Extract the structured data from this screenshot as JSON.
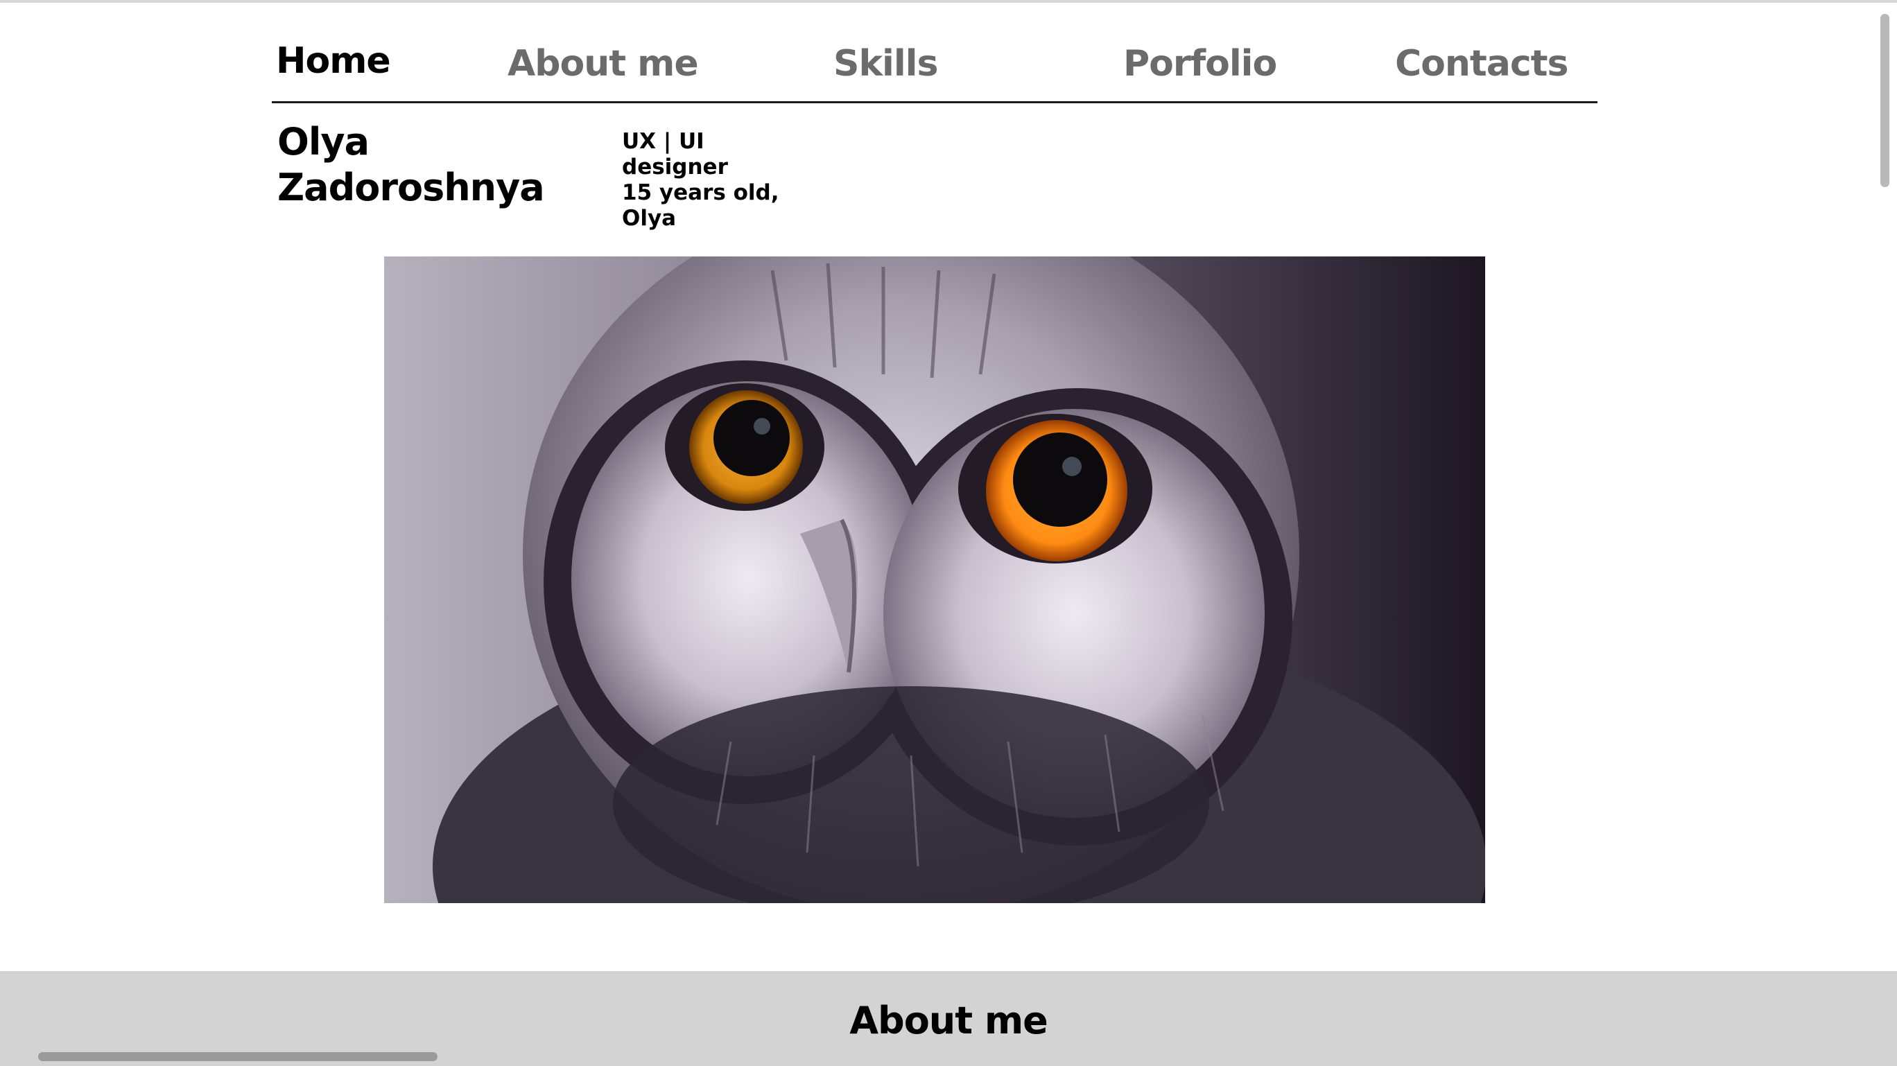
{
  "nav": {
    "items": [
      {
        "label": "Home"
      },
      {
        "label": "About me"
      },
      {
        "label": "Skills"
      },
      {
        "label": "Porfolio"
      },
      {
        "label": "Contacts"
      }
    ],
    "active_index": 0
  },
  "profile": {
    "first_name": "Olya",
    "last_name": "Zadoroshnya",
    "subtitle_lines": [
      "UX | UI",
      "designer",
      "15 years old,",
      "Olya"
    ]
  },
  "about_section": {
    "title": "About me"
  },
  "colors": {
    "nav_active": "#000000",
    "nav_inactive": "#6b6b6b",
    "band_background": "#d3d3d3",
    "owl_eye": "#ff8a12"
  }
}
